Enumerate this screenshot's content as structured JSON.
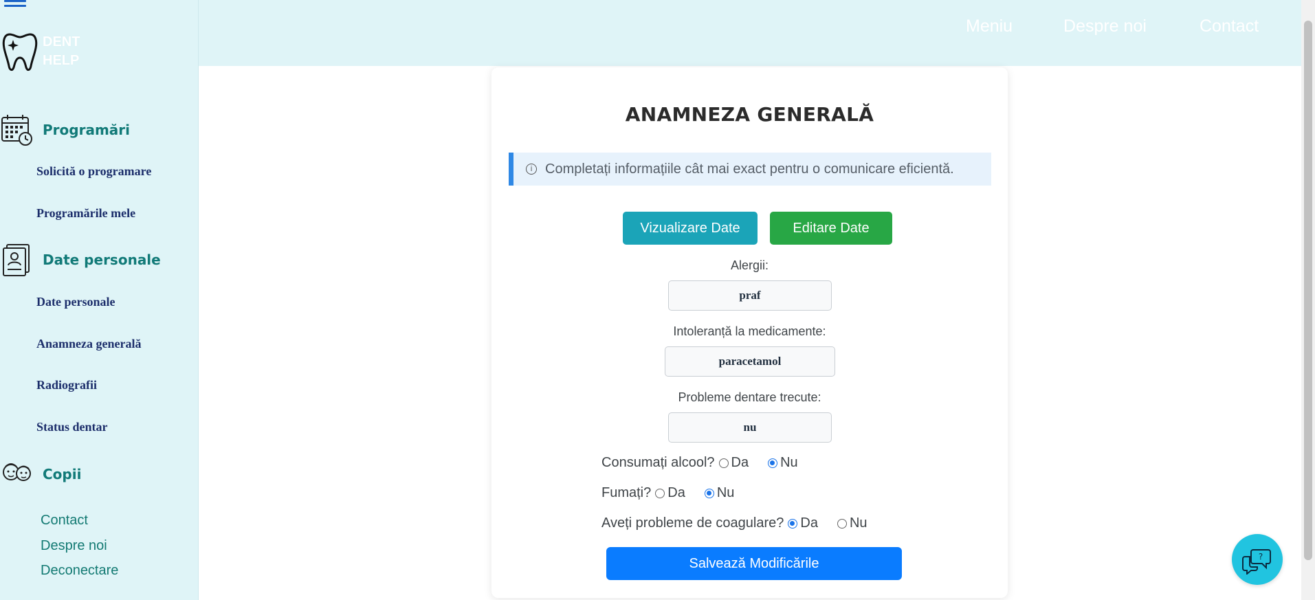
{
  "brand": {
    "line1": "DENT",
    "line2": "HELP"
  },
  "topnav": [
    {
      "label": "Meniu"
    },
    {
      "label": "Despre noi"
    },
    {
      "label": "Contact"
    }
  ],
  "sidebar": {
    "sections": [
      {
        "title": "Programări",
        "icon": "calendar-clock-icon",
        "items": [
          "Solicită o programare",
          "Programările mele"
        ]
      },
      {
        "title": "Date personale",
        "icon": "personal-file-icon",
        "items": [
          "Date personale",
          "Anamneza generală",
          "Radiografii",
          "Status dentar"
        ]
      },
      {
        "title": "Copii",
        "icon": "children-icon",
        "items": []
      }
    ],
    "footer_links": [
      "Contact",
      "Despre noi",
      "Deconectare"
    ]
  },
  "form": {
    "title": "ANAMNEZA GENERALĂ",
    "alert": "Completați informațiile cât mai exact pentru o comunicare eficientă.",
    "view_button": "Vizualizare Date",
    "edit_button": "Editare Date",
    "fields": [
      {
        "label": "Alergii:",
        "value": "praf"
      },
      {
        "label": "Intoleranță la medicamente:",
        "value": "paracetamol"
      },
      {
        "label": "Probleme dentare trecute:",
        "value": "nu"
      }
    ],
    "questions": [
      {
        "label": "Consumați alcool?",
        "options": [
          "Da",
          "Nu"
        ],
        "selected": "Nu"
      },
      {
        "label": "Fumați?",
        "options": [
          "Da",
          "Nu"
        ],
        "selected": "Nu"
      },
      {
        "label": "Aveți probleme de coagulare?",
        "options": [
          "Da",
          "Nu"
        ],
        "selected": "Da"
      }
    ],
    "save_button": "Salvează Modificările"
  },
  "colors": {
    "sidebar_bg": "#dff4f7",
    "section_title": "#117a78",
    "sub_item": "#1c2e6b",
    "view_button": "#1ba4b8",
    "edit_button": "#28a745",
    "save_button": "#0a7cff",
    "alert_border": "#2f88e5",
    "chat_button": "#21c4e0"
  },
  "icons": {
    "menu": "hamburger-icon",
    "logo": "tooth-logo-icon",
    "alert": "info-icon",
    "chat": "chat-help-icon"
  }
}
